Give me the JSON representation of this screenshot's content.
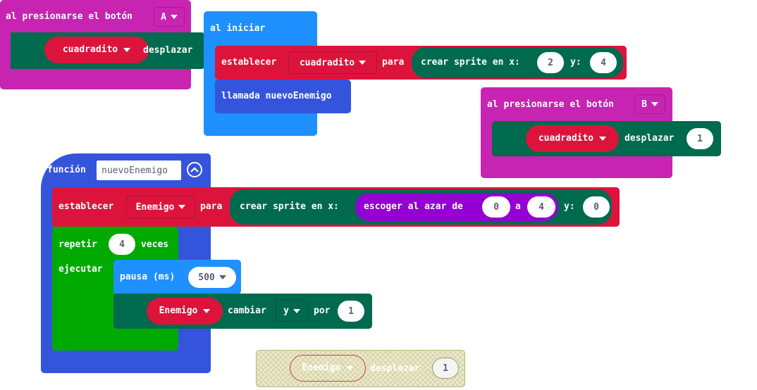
{
  "colors": {
    "events": "#c724b1",
    "basic": "#1e90ff",
    "sprites": "#006a4e",
    "sprite_var": "#dc143c",
    "functions": "#3455db",
    "loops": "#00aa00",
    "math": "#9400d3",
    "disabled": "#d7d5a4"
  },
  "block_a": {
    "label": "al presionarse el botón",
    "button": "A",
    "sprite": "cuadradito",
    "action": "desplazar"
  },
  "block_start": {
    "label": "al iniciar",
    "set_label": "establecer",
    "var": "cuadradito",
    "para": "para",
    "create_label": "crear sprite en x:",
    "x": "2",
    "y_label": "y:",
    "y": "4",
    "call_label": "llamada nuevoEnemigo"
  },
  "block_b": {
    "label": "al presionarse el botón",
    "button": "B",
    "sprite": "cuadradito",
    "action": "desplazar",
    "steps": "1"
  },
  "func": {
    "label": "función",
    "name": "nuevoEnemigo",
    "set_label": "establecer",
    "var": "Enemigo",
    "para": "para",
    "create_label": "crear sprite en x:",
    "random_label": "escoger al azar de",
    "from": "0",
    "to_label": "a",
    "to": "4",
    "y_label": "y:",
    "y": "0",
    "repeat_label": "repetir",
    "times": "4",
    "times_label": "veces",
    "do_label": "ejecutar",
    "pause_label": "pausa (ms)",
    "pause_value": "500",
    "change_sprite": "Enemigo",
    "change_label": "cambiar",
    "axis": "y",
    "by_label": "por",
    "by_value": "1"
  },
  "floating": {
    "sprite": "Enemigo",
    "action": "desplazar",
    "steps": "1"
  }
}
